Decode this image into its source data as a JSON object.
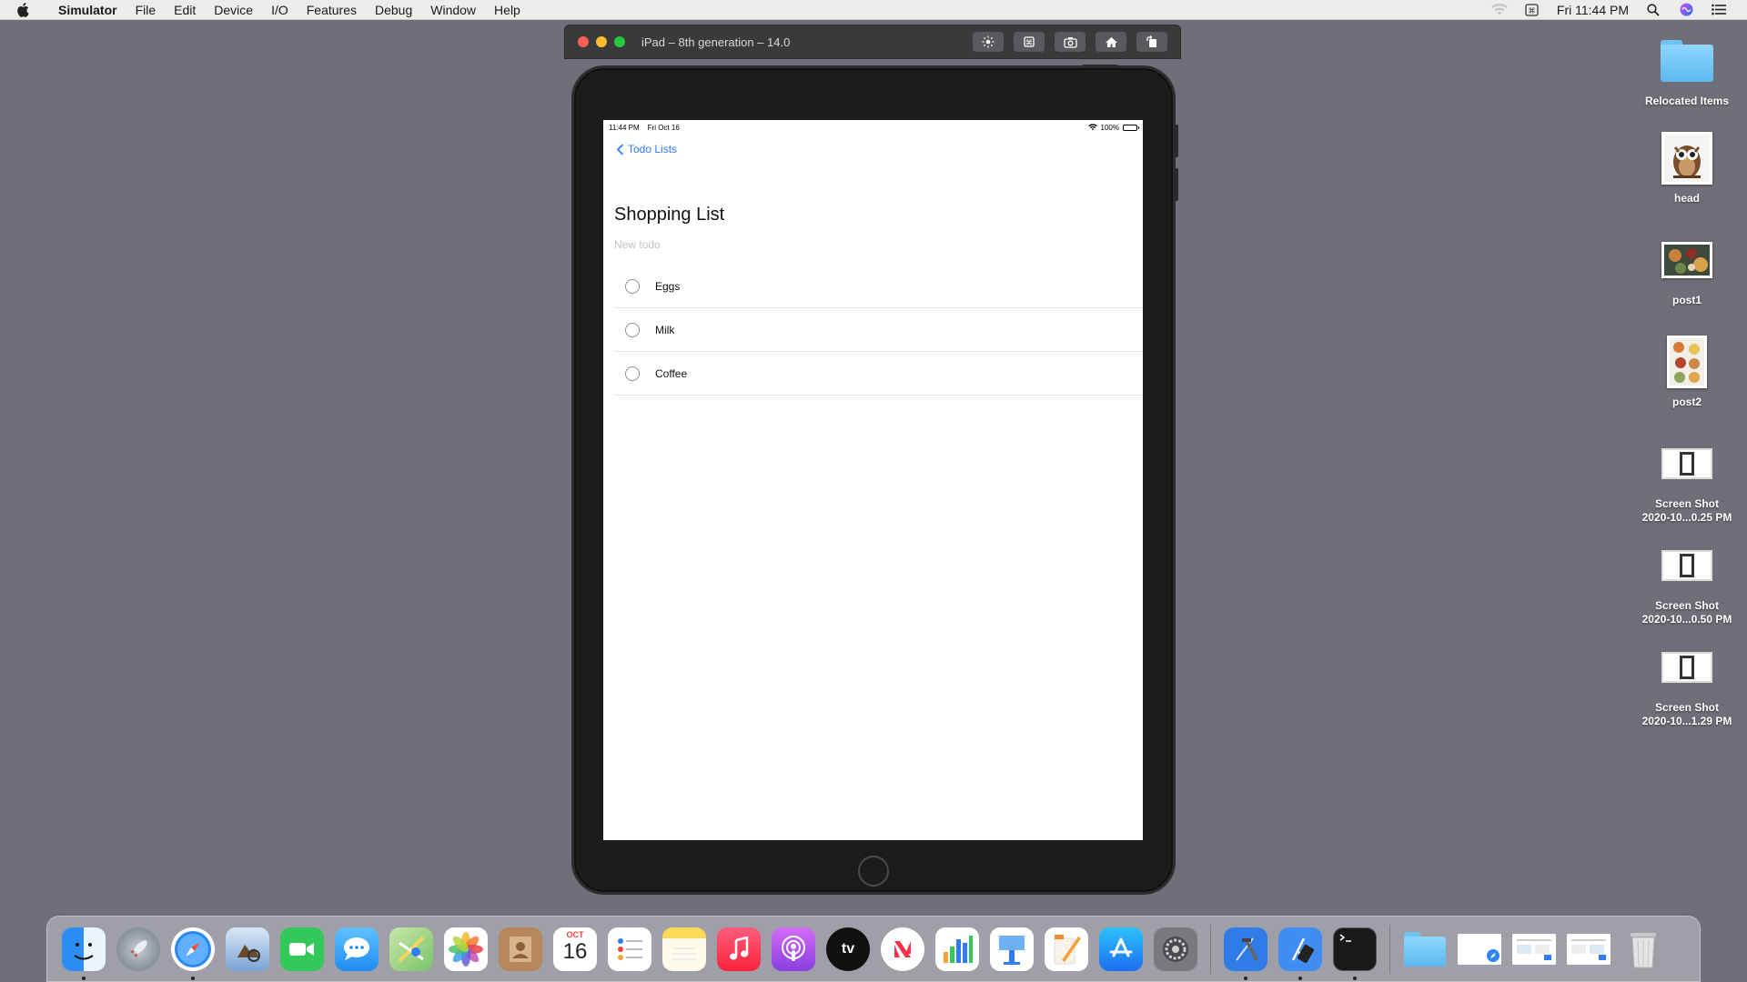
{
  "menubar": {
    "app_name": "Simulator",
    "menus": [
      "File",
      "Edit",
      "Device",
      "I/O",
      "Features",
      "Debug",
      "Window",
      "Help"
    ],
    "clock": "Fri 11:44 PM"
  },
  "simulator": {
    "window_title": "iPad – 8th generation – 14.0",
    "toolbar_icons": [
      "brightness-icon",
      "shake-icon",
      "screenshot-icon",
      "home-icon",
      "rotate-icon"
    ]
  },
  "device": {
    "status_time": "11:44 PM",
    "status_date": "Fri Oct 16",
    "battery_percent": "100%",
    "back_label": "Todo Lists",
    "title": "Shopping List",
    "new_todo_placeholder": "New todo",
    "todos": [
      {
        "text": "Eggs",
        "done": false
      },
      {
        "text": "Milk",
        "done": false
      },
      {
        "text": "Coffee",
        "done": false
      }
    ]
  },
  "desktop": {
    "items": [
      {
        "label_line1": "Relocated Items",
        "label_line2": "",
        "kind": "folder"
      },
      {
        "label_line1": "head",
        "label_line2": "",
        "kind": "photo"
      },
      {
        "label_line1": "post1",
        "label_line2": "",
        "kind": "photo"
      },
      {
        "label_line1": "post2",
        "label_line2": "",
        "kind": "photo"
      },
      {
        "label_line1": "Screen Shot",
        "label_line2": "2020-10...0.25 PM",
        "kind": "screenshot"
      },
      {
        "label_line1": "Screen Shot",
        "label_line2": "2020-10...0.50 PM",
        "kind": "screenshot"
      },
      {
        "label_line1": "Screen Shot",
        "label_line2": "2020-10...1.29 PM",
        "kind": "screenshot"
      }
    ]
  },
  "dock": {
    "calendar_month": "OCT",
    "calendar_day": "16",
    "tv_label": "tv",
    "apps": [
      {
        "name": "finder",
        "color": "#3b8df5",
        "running": true
      },
      {
        "name": "launchpad",
        "color": "#8e9aa8",
        "running": false
      },
      {
        "name": "safari",
        "color": "#2e86f0",
        "running": true
      },
      {
        "name": "preview",
        "color": "#6fa0d8",
        "running": false
      },
      {
        "name": "facetime",
        "color": "#34c759",
        "running": false
      },
      {
        "name": "messages",
        "color": "#3aa0f8",
        "running": false
      },
      {
        "name": "maps",
        "color": "#7cc36b",
        "running": false
      },
      {
        "name": "photos",
        "color": "#f2f2f2",
        "running": false
      },
      {
        "name": "contacts",
        "color": "#b6875a",
        "running": false
      },
      {
        "name": "calendar",
        "color": "#ffffff",
        "running": false
      },
      {
        "name": "reminders",
        "color": "#ffffff",
        "running": false
      },
      {
        "name": "notes",
        "color": "#ffe066",
        "running": false
      },
      {
        "name": "music",
        "color": "#fc3c44",
        "running": false
      },
      {
        "name": "podcasts",
        "color": "#a34ff2",
        "running": false
      },
      {
        "name": "tv",
        "color": "#111111",
        "running": false
      },
      {
        "name": "news",
        "color": "#f5f5f5",
        "running": false
      },
      {
        "name": "numbers",
        "color": "#ffffff",
        "running": false
      },
      {
        "name": "keynote",
        "color": "#ffffff",
        "running": false
      },
      {
        "name": "pages",
        "color": "#ffffff",
        "running": false
      },
      {
        "name": "app-store",
        "color": "#1c8cf5",
        "running": false
      },
      {
        "name": "system-preferences",
        "color": "#7a7a7e",
        "running": false
      },
      {
        "name": "xcode",
        "color": "#2f7ce8",
        "running": true
      },
      {
        "name": "simulator",
        "color": "#3f8df0",
        "running": true
      },
      {
        "name": "terminal",
        "color": "#1a1a1a",
        "running": true
      },
      {
        "name": "downloads-folder",
        "color": "#79c7f5",
        "running": false
      },
      {
        "name": "recent-doc-1",
        "color": "#ffffff",
        "running": false
      },
      {
        "name": "recent-doc-2",
        "color": "#ffffff",
        "running": false
      },
      {
        "name": "recent-doc-3",
        "color": "#ffffff",
        "running": false
      },
      {
        "name": "trash",
        "color": "#d8d8d8",
        "running": false
      }
    ]
  },
  "colors": {
    "desktop_bg": "#6e6f78",
    "accent_blue": "#2f7cf6",
    "menubar_bg": "#ececec"
  }
}
